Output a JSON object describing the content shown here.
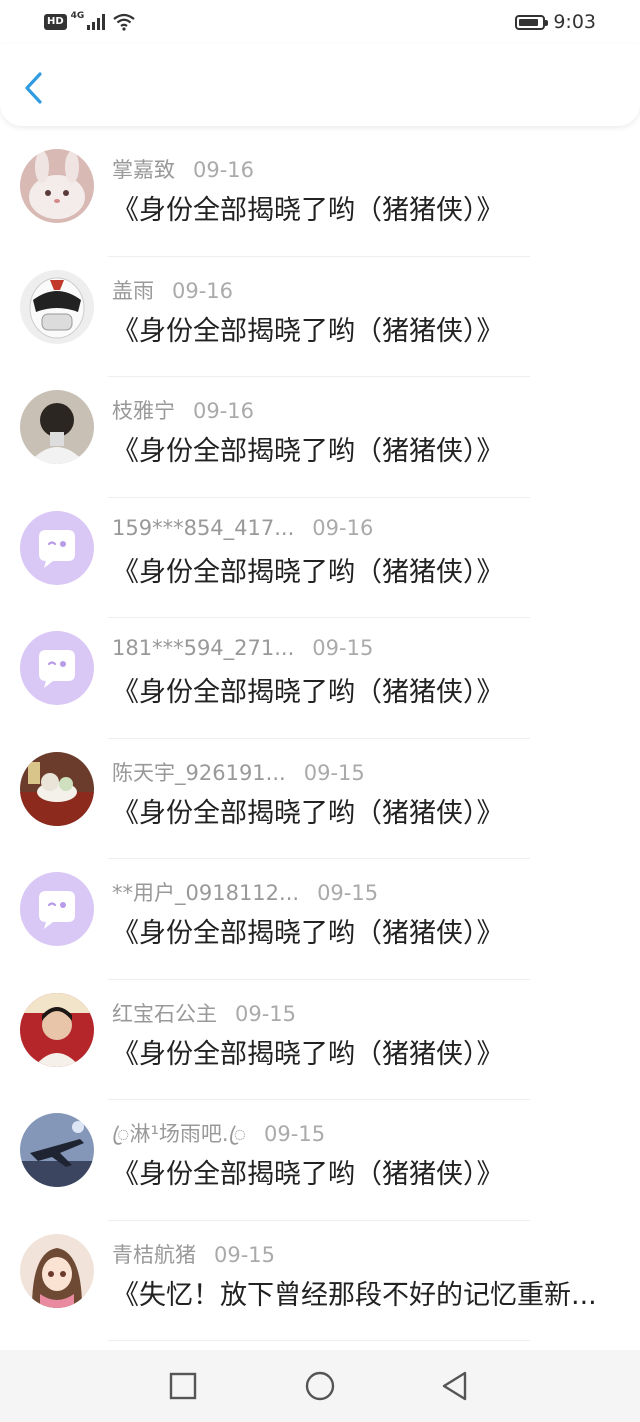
{
  "status_bar": {
    "hd_label": "HD",
    "network_label": "4G",
    "time": "9:03",
    "battery_level": 0.85
  },
  "header": {
    "back_icon": "chevron-left-icon",
    "accent": "#2f9be0"
  },
  "list": [
    {
      "name": "掌嘉致",
      "date": "09-16",
      "title": "《身份全部揭晓了哟（猪猪侠）》",
      "avatar": "rabbit-photo"
    },
    {
      "name": "盖雨",
      "date": "09-16",
      "title": "《身份全部揭晓了哟（猪猪侠）》",
      "avatar": "robot-helmet-photo"
    },
    {
      "name": "枝雅宁",
      "date": "09-16",
      "title": "《身份全部揭晓了哟（猪猪侠）》",
      "avatar": "person-photo"
    },
    {
      "name": "159***854_417...",
      "date": "09-16",
      "title": "《身份全部揭晓了哟（猪猪侠）》",
      "avatar": "default-chat-bubble"
    },
    {
      "name": "181***594_271...",
      "date": "09-15",
      "title": "《身份全部揭晓了哟（猪猪侠）》",
      "avatar": "default-chat-bubble"
    },
    {
      "name": "陈天宇_926191...",
      "date": "09-15",
      "title": "《身份全部揭晓了哟（猪猪侠）》",
      "avatar": "food-photo"
    },
    {
      "name": "**用户_0918112...",
      "date": "09-15",
      "title": "《身份全部揭晓了哟（猪猪侠）》",
      "avatar": "default-chat-bubble"
    },
    {
      "name": "红宝石公主",
      "date": "09-15",
      "title": "《身份全部揭晓了哟（猪猪侠）》",
      "avatar": "girl-photo"
    },
    {
      "name": "ꦿ淋¹场雨吧.ꦿ",
      "date": "09-15",
      "title": "《身份全部揭晓了哟（猪猪侠）》",
      "avatar": "plane-photo"
    },
    {
      "name": "青桔航猪",
      "date": "09-15",
      "title": "《失忆！放下曾经那段不好的记忆重新...",
      "avatar": "anime-girl-photo"
    }
  ],
  "nav_bar": {
    "recent_icon": "square-icon",
    "home_icon": "circle-icon",
    "back_icon": "triangle-back-icon"
  },
  "colors": {
    "default_avatar_bg": "#d9c8f5",
    "name_gray": "#999999",
    "title_black": "#222222"
  }
}
